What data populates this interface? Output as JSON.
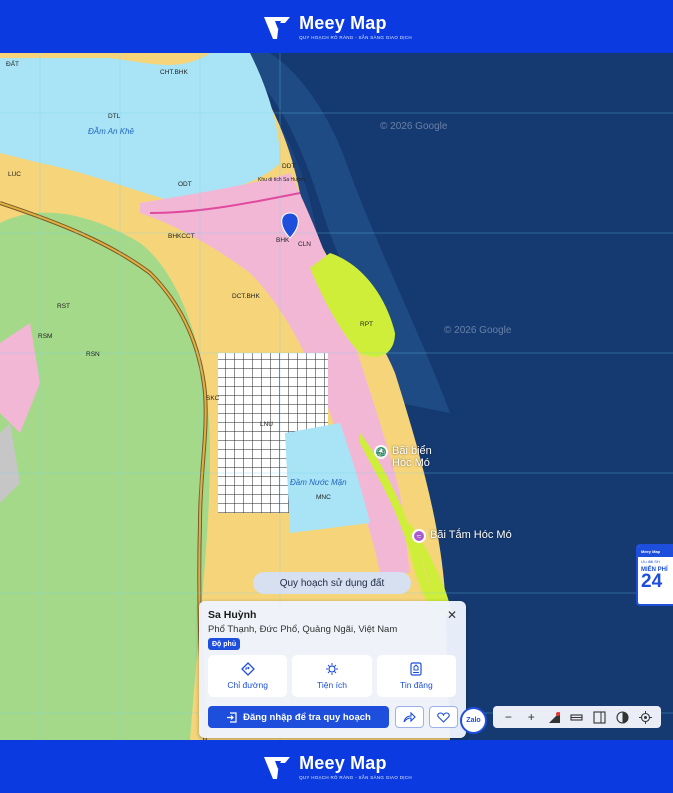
{
  "brand": {
    "name": "Meey Map",
    "slogan": "QUY HOẠCH RÕ RÀNG - SẴN SÀNG GIAO DỊCH"
  },
  "colors": {
    "brand_blue": "#0b3be0",
    "accent": "#1e4fdc",
    "sea": "#1b3f78",
    "water": "#a9e4f6",
    "forest": "#a5d98a",
    "residential": "#f3b7d6",
    "beach": "#cfee3a"
  },
  "map": {
    "labels": [
      "ĐẤT",
      "CHT.BHK",
      "DTL",
      "ĐẦm An Khê",
      "LUC",
      "DDT",
      "Khu di tích Sa Huỳnh",
      "BHK",
      "CLN",
      "RSN",
      "RST",
      "RSM",
      "BHKCCT",
      "RPT",
      "DCT.BHK",
      "LNU",
      "Đầm Nước Mặn",
      "MNC",
      "SKC",
      "ODT"
    ],
    "copyright": "© 2026 Google",
    "pois": [
      {
        "name": "Bãi biển Hóc Mó",
        "icon": "beach-icon"
      },
      {
        "name": "Bãi Tắm Hóc Mó",
        "icon": "swim-icon"
      }
    ]
  },
  "layer_pill": "Quy hoạch sử dụng đất",
  "info": {
    "title": "Sa Huỳnh",
    "address": "Phổ Thạnh, Đức Phổ, Quảng Ngãi, Việt Nam",
    "badge": "Độ phủ",
    "close": "✕",
    "actions": [
      {
        "label": "Chỉ đường",
        "icon": "directions-icon"
      },
      {
        "label": "Tiện ích",
        "icon": "amenities-icon"
      },
      {
        "label": "Tin đăng",
        "icon": "listings-icon"
      }
    ],
    "login_label": "Đăng nhập để tra quy hoạch"
  },
  "zalo": "Zalo",
  "toolbar": {
    "zoom_out": "−",
    "zoom_in": "+"
  },
  "side_ad": {
    "header": "Meey Map",
    "sub": "Ưu đãi SH",
    "label": "MIỄN PHÍ",
    "number": "24"
  }
}
